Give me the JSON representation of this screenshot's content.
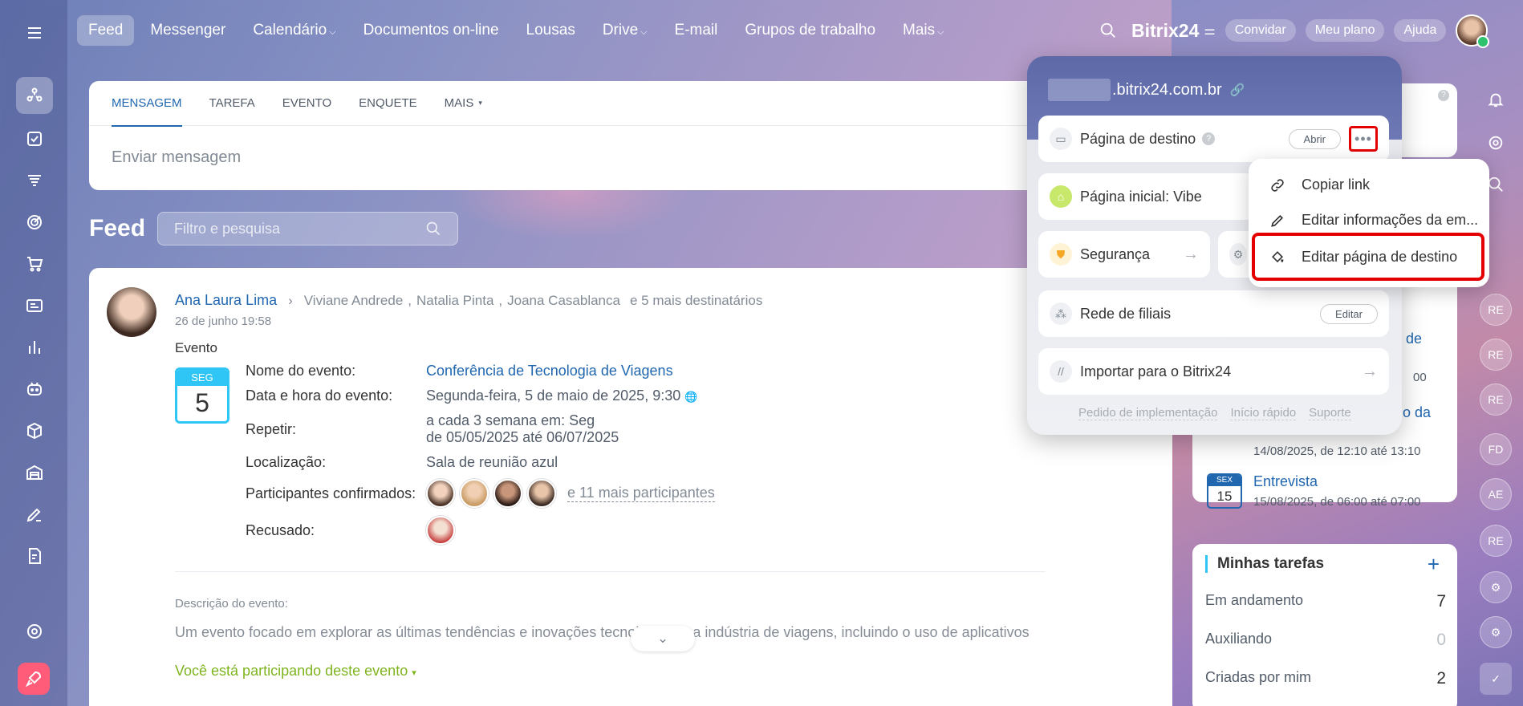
{
  "topnav": {
    "items": [
      {
        "label": "Feed",
        "active": true
      },
      {
        "label": "Messenger"
      },
      {
        "label": "Calendário",
        "dropdown": true
      },
      {
        "label": "Documentos on-line"
      },
      {
        "label": "Lousas"
      },
      {
        "label": "Drive",
        "dropdown": true
      },
      {
        "label": "E-mail"
      },
      {
        "label": "Grupos de trabalho"
      },
      {
        "label": "Mais",
        "dropdown": true
      }
    ],
    "brand": "Bitrix24",
    "invite": "Convidar",
    "plan": "Meu plano",
    "help": "Ajuda"
  },
  "composer": {
    "tabs": [
      "MENSAGEM",
      "TAREFA",
      "EVENTO",
      "ENQUETE",
      "MAIS"
    ],
    "placeholder": "Enviar mensagem"
  },
  "feed": {
    "title": "Feed",
    "filter_placeholder": "Filtro e pesquisa"
  },
  "post": {
    "author": "Ana Laura Lima",
    "recipients": [
      "Viviane Andrede",
      "Natalia Pinta",
      "Joana Casablanca"
    ],
    "more_recipients": "e 5 mais destinatários",
    "date": "26 de junho 19:58",
    "type_label": "Evento",
    "calendar": {
      "weekday": "SEG",
      "day": "5"
    },
    "fields": {
      "name_label": "Nome do evento:",
      "name_value": "Conferência de Tecnologia de Viagens",
      "datetime_label": "Data e hora do evento:",
      "datetime_value": "Segunda-feira, 5 de maio de 2025, 9:30",
      "repeat_label": "Repetir:",
      "repeat_line1": "a cada 3 semana em: Seg",
      "repeat_line2": "de 05/05/2025 até 06/07/2025",
      "location_label": "Localização:",
      "location_value": "Sala de reunião azul",
      "confirmed_label": "Participantes confirmados:",
      "confirmed_more": "e 11 mais participantes",
      "declined_label": "Recusado:"
    },
    "description_label": "Descrição do evento:",
    "description_text": "Um evento focado em explorar as últimas tendências e inovações tecnológicas na indústria de viagens, incluindo o uso de aplicativos",
    "participating": "Você está participando deste evento"
  },
  "upcoming": {
    "partial_title": "de",
    "partial_time": "00",
    "partial_title2": "o da",
    "ev2_time": "14/08/2025, de 12:10 até 13:10",
    "ev3": {
      "weekday": "SEX",
      "day": "15",
      "name": "Entrevista",
      "time": "15/08/2025, de 06:00 até 07:00"
    }
  },
  "tasks": {
    "title": "Minhas tarefas",
    "rows": [
      {
        "label": "Em andamento",
        "count": "7"
      },
      {
        "label": "Auxiliando",
        "count": "0"
      },
      {
        "label": "Criadas por mim",
        "count": "2"
      }
    ]
  },
  "rightbar": {
    "initials": [
      "RE",
      "RE",
      "RE",
      "FD",
      "AE",
      "RE"
    ]
  },
  "portal": {
    "domain": ".bitrix24.com.br",
    "landing": "Página de destino",
    "landing_open": "Abrir",
    "home": "Página inicial: Vibe",
    "security": "Segurança",
    "branches": "Rede de filiais",
    "branches_edit": "Editar",
    "import": "Importar para o Bitrix24",
    "footer": [
      "Pedido de implementação",
      "Início rápido",
      "Suporte"
    ]
  },
  "context_menu": {
    "items": [
      "Copiar link",
      "Editar informações da em...",
      "Editar página de destino"
    ]
  },
  "colors": {
    "accent": "#2067b0",
    "highlight": "#e40000",
    "calendar": "#2fc6f6",
    "success": "#7fb41f"
  }
}
